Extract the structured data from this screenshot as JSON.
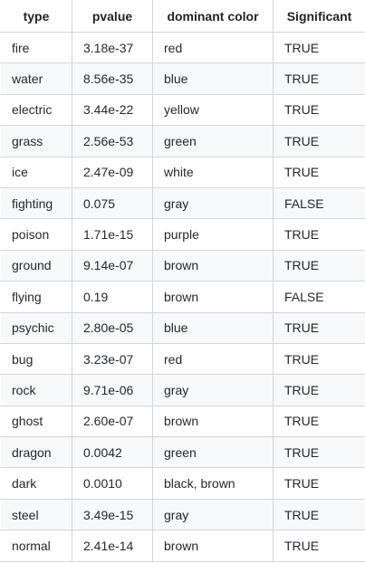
{
  "table": {
    "columns": [
      "type",
      "pvalue",
      "dominant color",
      "Significant"
    ],
    "rows": [
      [
        "fire",
        "3.18e-37",
        "red",
        "TRUE"
      ],
      [
        "water",
        "8.56e-35",
        "blue",
        "TRUE"
      ],
      [
        "electric",
        "3.44e-22",
        "yellow",
        "TRUE"
      ],
      [
        "grass",
        "2.56e-53",
        "green",
        "TRUE"
      ],
      [
        "ice",
        "2.47e-09",
        "white",
        "TRUE"
      ],
      [
        "fighting",
        "0.075",
        "gray",
        "FALSE"
      ],
      [
        "poison",
        "1.71e-15",
        "purple",
        "TRUE"
      ],
      [
        "ground",
        "9.14e-07",
        "brown",
        "TRUE"
      ],
      [
        "flying",
        "0.19",
        "brown",
        "FALSE"
      ],
      [
        "psychic",
        "2.80e-05",
        "blue",
        "TRUE"
      ],
      [
        "bug",
        "3.23e-07",
        "red",
        "TRUE"
      ],
      [
        "rock",
        "9.71e-06",
        "gray",
        "TRUE"
      ],
      [
        "ghost",
        "2.60e-07",
        "brown",
        "TRUE"
      ],
      [
        "dragon",
        "0.0042",
        "green",
        "TRUE"
      ],
      [
        "dark",
        "0.0010",
        "black, brown",
        "TRUE"
      ],
      [
        "steel",
        "3.49e-15",
        "gray",
        "TRUE"
      ],
      [
        "normal",
        "2.41e-14",
        "brown",
        "TRUE"
      ]
    ]
  }
}
